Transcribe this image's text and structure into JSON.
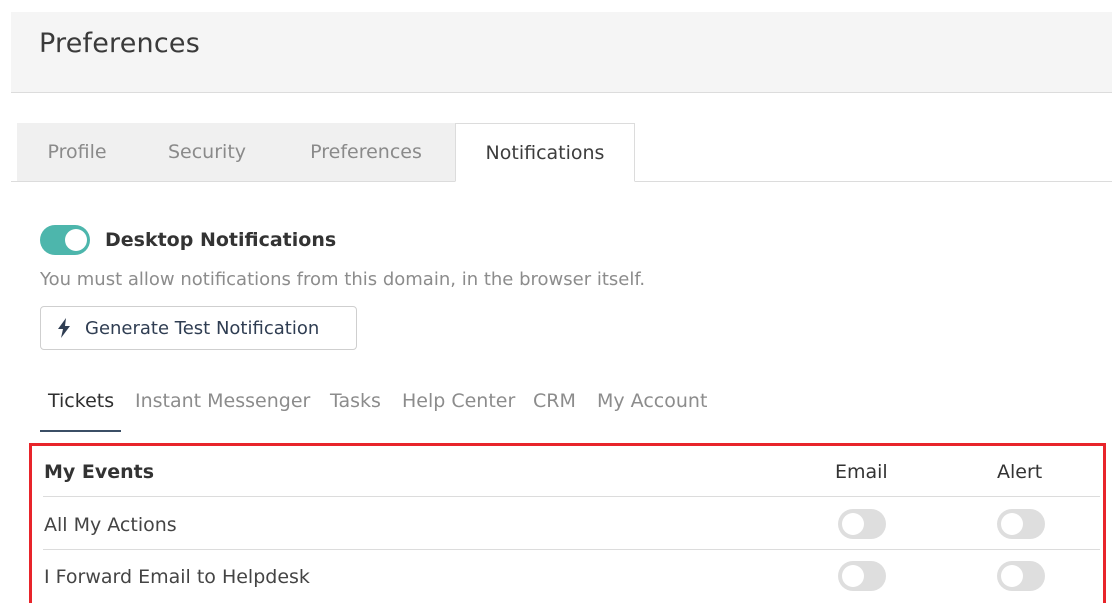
{
  "header": {
    "title": "Preferences"
  },
  "tabs": [
    {
      "label": "Profile"
    },
    {
      "label": "Security"
    },
    {
      "label": "Preferences"
    },
    {
      "label": "Notifications"
    }
  ],
  "desktop": {
    "label": "Desktop Notifications",
    "enabled": true,
    "help": "You must allow notifications from this domain, in the browser itself.",
    "test_button": "Generate Test Notification"
  },
  "subtabs": [
    {
      "label": "Tickets"
    },
    {
      "label": "Instant Messenger"
    },
    {
      "label": "Tasks"
    },
    {
      "label": "Help Center"
    },
    {
      "label": "CRM"
    },
    {
      "label": "My Account"
    }
  ],
  "events": {
    "title": "My Events",
    "col_email": "Email",
    "col_alert": "Alert",
    "rows": [
      {
        "label": "All My Actions",
        "email": false,
        "alert": false
      },
      {
        "label": "I Forward Email to Helpdesk",
        "email": false,
        "alert": false
      }
    ]
  },
  "colors": {
    "accent": "#4db6ac",
    "highlight": "#e8242a",
    "subtab_underline": "#3b4f66"
  }
}
